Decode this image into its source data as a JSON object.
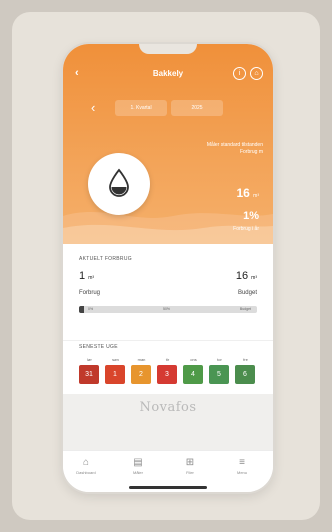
{
  "header": {
    "title": "Bakkely",
    "back_icon": "‹",
    "info_icon": "i",
    "home_icon": "⌂"
  },
  "period": {
    "back_icon": "‹",
    "btn1": "1. Kvartal",
    "btn2": "2025"
  },
  "hero": {
    "note": "Måler standard tilstanden Forbrug m",
    "big_value": "16",
    "big_unit": "m³",
    "pct_value": "1%",
    "pct_unit": "",
    "sub": "Forbrug i år"
  },
  "consumption": {
    "section_title": "AKTUELT FORBRUG",
    "left_value": "1",
    "left_unit": "m³",
    "left_label": "Forbrug",
    "right_value": "16",
    "right_unit": "m³",
    "right_label": "Budget",
    "progress_fraction": 0.03,
    "marks": [
      "0%",
      "50%",
      "Budget"
    ]
  },
  "week": {
    "section_title": "SENESTE UGE",
    "days": [
      {
        "name": "lør",
        "value": "31",
        "color": "#c0392b"
      },
      {
        "name": "søn",
        "value": "1",
        "color": "#d9452b"
      },
      {
        "name": "man",
        "value": "2",
        "color": "#e7952e"
      },
      {
        "name": "tir",
        "value": "3",
        "color": "#d53a32"
      },
      {
        "name": "ons",
        "value": "4",
        "color": "#4f9a48"
      },
      {
        "name": "tor",
        "value": "5",
        "color": "#4a9553"
      },
      {
        "name": "fre",
        "value": "6",
        "color": "#4b8d4d"
      }
    ]
  },
  "brand": {
    "name": "Novafos"
  },
  "nav": {
    "items": [
      {
        "label": "Dashboard",
        "icon": "⌂"
      },
      {
        "label": "Måler",
        "icon": "▤"
      },
      {
        "label": "Filer",
        "icon": "⊞"
      },
      {
        "label": "Menu",
        "icon": "≡"
      }
    ]
  },
  "colors": {
    "accent": "#f0903a",
    "accent_light": "#f5b06b"
  }
}
